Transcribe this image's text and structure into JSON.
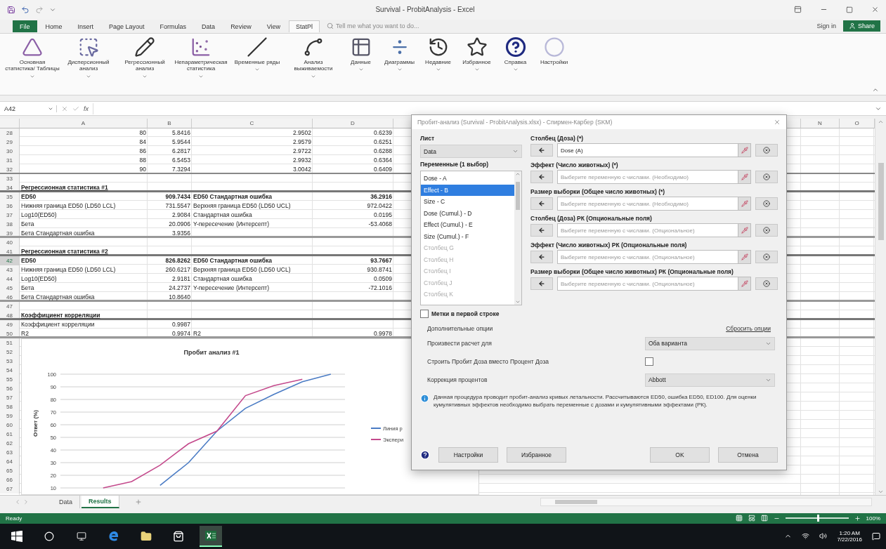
{
  "window": {
    "title": "Survival - ProbitAnalysis - Excel",
    "sign_in": "Sign in",
    "share": "Share"
  },
  "ribbon_tabs": [
    {
      "label": "File",
      "kind": "file",
      "selected": false
    },
    {
      "label": "Home",
      "kind": "tab",
      "selected": false
    },
    {
      "label": "Insert",
      "kind": "tab",
      "selected": false
    },
    {
      "label": "Page Layout",
      "kind": "tab",
      "selected": false
    },
    {
      "label": "Formulas",
      "kind": "tab",
      "selected": false
    },
    {
      "label": "Data",
      "kind": "tab",
      "selected": false
    },
    {
      "label": "Review",
      "kind": "tab",
      "selected": false
    },
    {
      "label": "View",
      "kind": "tab",
      "selected": false
    },
    {
      "label": "StatPl",
      "kind": "tab",
      "selected": true
    }
  ],
  "tell_me": "Tell me what you want to do...",
  "ribbon": [
    {
      "label": "Основная статистика/ Таблицы",
      "dropdown": true
    },
    {
      "label": "Дисперсионный анализ",
      "dropdown": true
    },
    {
      "label": "Регрессионный анализ",
      "dropdown": true
    },
    {
      "label": "Непараметрическая статистика",
      "dropdown": true
    },
    {
      "label": "Временные ряды",
      "dropdown": true
    },
    {
      "label": "Анализ выживаемости",
      "dropdown": true
    },
    {
      "label": "Данные",
      "dropdown": true
    },
    {
      "label": "Диаграммы",
      "dropdown": true
    },
    {
      "label": "Недавние",
      "dropdown": true
    },
    {
      "label": "Избранное",
      "dropdown": true
    },
    {
      "label": "Справка",
      "dropdown": true
    },
    {
      "label": "Настройки",
      "dropdown": false
    }
  ],
  "formula_bar": {
    "name_box": "A42",
    "fx": "fx"
  },
  "sheet": {
    "columns": [
      "A",
      "B",
      "C",
      "D",
      "N",
      "O"
    ],
    "rows": [
      {
        "num": "28",
        "kind": "data",
        "bold": false,
        "selected": false,
        "cells": [
          "80",
          "5.8416",
          "2.9502",
          "0.6239"
        ]
      },
      {
        "num": "29",
        "kind": "data",
        "bold": false,
        "selected": false,
        "cells": [
          "84",
          "5.9544",
          "2.9579",
          "0.6251"
        ]
      },
      {
        "num": "30",
        "kind": "data",
        "bold": false,
        "selected": false,
        "cells": [
          "86",
          "6.2817",
          "2.9722",
          "0.6288"
        ]
      },
      {
        "num": "31",
        "kind": "data",
        "bold": false,
        "selected": false,
        "cells": [
          "88",
          "6.5453",
          "2.9932",
          "0.6364"
        ]
      },
      {
        "num": "32",
        "kind": "data_last",
        "bold": false,
        "selected": false,
        "cells": [
          "90",
          "7.3294",
          "3.0042",
          "0.6409"
        ]
      },
      {
        "num": "33",
        "kind": "empty",
        "selected": false,
        "cells": []
      },
      {
        "num": "34",
        "kind": "heading",
        "bold": true,
        "selected": false,
        "cells": [
          "Регрессионная статистика #1"
        ]
      },
      {
        "num": "35",
        "kind": "stat",
        "bold": true,
        "selected": false,
        "cells": [
          "ED50",
          "909.7434",
          "ED50 Стандартная ошибка",
          "36.2916"
        ]
      },
      {
        "num": "36",
        "kind": "stat",
        "bold": false,
        "selected": false,
        "cells": [
          "Нижняя граница ED50 (LD50 LCL)",
          "731.5547",
          "Верхняя граница ED50 (LD50 UCL)",
          "972.0422"
        ]
      },
      {
        "num": "37",
        "kind": "stat",
        "bold": false,
        "selected": false,
        "cells": [
          "Log10(ED50)",
          "2.9084",
          "Стандартная ошибка",
          "0.0195"
        ]
      },
      {
        "num": "38",
        "kind": "stat",
        "bold": false,
        "selected": false,
        "cells": [
          "Бета",
          "20.0906",
          "Y-пересечение (Интерсепт)",
          "-53.4068"
        ]
      },
      {
        "num": "39",
        "kind": "stat_last",
        "bold": false,
        "selected": false,
        "cells": [
          "Бета Стандартная ошибка",
          "3.9356"
        ]
      },
      {
        "num": "40",
        "kind": "empty",
        "selected": false,
        "cells": []
      },
      {
        "num": "41",
        "kind": "heading",
        "bold": true,
        "selected": false,
        "cells": [
          "Регрессионная статистика #2"
        ]
      },
      {
        "num": "42",
        "kind": "stat",
        "bold": true,
        "selected": true,
        "cells": [
          "ED50",
          "826.8262",
          "ED50 Стандартная ошибка",
          "93.7667"
        ]
      },
      {
        "num": "43",
        "kind": "stat",
        "bold": false,
        "selected": false,
        "cells": [
          "Нижняя граница ED50 (LD50 LCL)",
          "260.6217",
          "Верхняя граница ED50 (LD50 UCL)",
          "930.8741"
        ]
      },
      {
        "num": "44",
        "kind": "stat",
        "bold": false,
        "selected": false,
        "cells": [
          "Log10(ED50)",
          "2.9181",
          "Стандартная ошибка",
          "0.0509"
        ]
      },
      {
        "num": "45",
        "kind": "stat",
        "bold": false,
        "selected": false,
        "cells": [
          "Бета",
          "24.2737",
          "Y-пересечение (Интерсепт)",
          "-72.1016"
        ]
      },
      {
        "num": "46",
        "kind": "stat_last",
        "bold": false,
        "selected": false,
        "cells": [
          "Бета Стандартная ошибка",
          "10.8640"
        ]
      },
      {
        "num": "47",
        "kind": "empty",
        "selected": false,
        "cells": []
      },
      {
        "num": "48",
        "kind": "heading",
        "bold": true,
        "selected": false,
        "cells": [
          "Коэффициент корреляции"
        ]
      },
      {
        "num": "49",
        "kind": "stat",
        "bold": false,
        "selected": false,
        "cells": [
          "Коэффициент корреляции",
          "0.9987"
        ]
      },
      {
        "num": "50",
        "kind": "stat_last",
        "bold": false,
        "selected": false,
        "cells": [
          "R2",
          "0.9974",
          "R2",
          "0.9978"
        ]
      },
      {
        "num": "51",
        "kind": "empty",
        "selected": false,
        "cells": []
      },
      {
        "num": "52",
        "kind": "empty",
        "selected": false,
        "cells": []
      },
      {
        "num": "53",
        "kind": "empty",
        "selected": false,
        "cells": []
      },
      {
        "num": "54",
        "kind": "empty",
        "selected": false,
        "cells": []
      },
      {
        "num": "55",
        "kind": "empty",
        "selected": false,
        "cells": []
      },
      {
        "num": "56",
        "kind": "empty",
        "selected": false,
        "cells": []
      },
      {
        "num": "57",
        "kind": "empty",
        "selected": false,
        "cells": []
      },
      {
        "num": "58",
        "kind": "empty",
        "selected": false,
        "cells": []
      },
      {
        "num": "59",
        "kind": "empty",
        "selected": false,
        "cells": []
      },
      {
        "num": "60",
        "kind": "empty",
        "selected": false,
        "cells": []
      },
      {
        "num": "61",
        "kind": "empty",
        "selected": false,
        "cells": []
      },
      {
        "num": "62",
        "kind": "empty",
        "selected": false,
        "cells": []
      },
      {
        "num": "63",
        "kind": "empty",
        "selected": false,
        "cells": []
      },
      {
        "num": "64",
        "kind": "empty",
        "selected": false,
        "cells": []
      },
      {
        "num": "65",
        "kind": "empty",
        "selected": false,
        "cells": []
      },
      {
        "num": "66",
        "kind": "empty",
        "selected": false,
        "cells": []
      },
      {
        "num": "67",
        "kind": "empty",
        "selected": false,
        "cells": []
      }
    ]
  },
  "chart": {
    "chart_data": {
      "type": "line",
      "title": "Пробит анализ #1",
      "ylabel": "Ответ (%)",
      "grid": true,
      "legend": "right",
      "ylim": [
        10,
        100
      ],
      "yticks": [
        10,
        20,
        30,
        40,
        50,
        60,
        70,
        80,
        90,
        100
      ],
      "categories": [
        null,
        null,
        null,
        null,
        null,
        null,
        null,
        null,
        null,
        null
      ],
      "series": [
        {
          "name": "Линия р",
          "color": "#4a7bc4",
          "values": [
            null,
            null,
            null,
            12,
            30,
            55,
            73,
            84,
            94,
            100
          ]
        },
        {
          "name": "Экспери",
          "color": "#c44a8c",
          "values": [
            null,
            10,
            15,
            28,
            45,
            55,
            83,
            91,
            96,
            null
          ]
        }
      ]
    }
  },
  "dialog": {
    "title": "Пробит-анализ (Survival - ProbitAnalysis.xlsx) - Спирмен-Карбер (SKM)",
    "sheet_label": "Лист",
    "sheet_value": "Data",
    "variables_label": "Переменные (1 выбор)",
    "variables": [
      {
        "label": "Dose - A",
        "selected": false,
        "disabled": false
      },
      {
        "label": "Effect - B",
        "selected": true,
        "disabled": false
      },
      {
        "label": "Size - C",
        "selected": false,
        "disabled": false
      },
      {
        "label": "Dose (Cumul.) - D",
        "selected": false,
        "disabled": false
      },
      {
        "label": "Effect (Cumul.) - E",
        "selected": false,
        "disabled": false
      },
      {
        "label": "Size (Cumul.) - F",
        "selected": false,
        "disabled": false
      },
      {
        "label": "Столбец G",
        "selected": false,
        "disabled": true
      },
      {
        "label": "Столбец H",
        "selected": false,
        "disabled": true
      },
      {
        "label": "Столбец I",
        "selected": false,
        "disabled": true
      },
      {
        "label": "Столбец J",
        "selected": false,
        "disabled": true
      },
      {
        "label": "Столбец K",
        "selected": false,
        "disabled": true
      }
    ],
    "fields": [
      {
        "label": "Столбец (Доза) (*)",
        "value": "Dose (A)"
      },
      {
        "label": "Эффект (Число животных) (*)",
        "placeholder": "Выберите переменную с числами. (Необходимо)"
      },
      {
        "label": "Размер выборки (Общее число животных) (*)",
        "placeholder": "Выберите переменную с числами. (Необходимо)"
      },
      {
        "label": "Столбец (Доза) РК (Опциональные поля)",
        "placeholder": "Выберите переменную с числами. (Опциональное)"
      },
      {
        "label": "Эффект (Число животных) РК (Опциональные поля)",
        "placeholder": "Выберите переменную с числами. (Опциональное)"
      },
      {
        "label": "Размер выборки (Общее число животных) РК (Опциональные поля)",
        "placeholder": "Выберите переменную с числами. (Опциональное)"
      }
    ],
    "labels_checkbox": {
      "label": "Метки в первой строке",
      "checked": false
    },
    "options_label": "Дополнительные опции",
    "reset_link": "Сбросить опции",
    "options": [
      {
        "kind": "select",
        "label": "Произвести расчет для",
        "value": "Оба варианта"
      },
      {
        "kind": "checkbox",
        "label": "Строить Пробит Доза вместо Процент Доза",
        "checked": false
      },
      {
        "kind": "select",
        "label": "Коррекция процентов",
        "value": "Abbott"
      }
    ],
    "info": "Данная процедура проводит пробит-анализ кривых летальности. Рассчитываются ED50, ошибка ED50, ED100. Для оценки кумулятивных эффектов необходимо выбрать переменные с дозами и кумулятивными эффектами (РК).",
    "buttons": [
      {
        "label": "Настройки",
        "kind": "left"
      },
      {
        "label": "Избранное",
        "kind": "left"
      },
      {
        "label": "OK",
        "kind": "right"
      },
      {
        "label": "Отмена",
        "kind": "right"
      }
    ]
  },
  "sheet_tabs": [
    {
      "label": "Data",
      "selected": false
    },
    {
      "label": "Results",
      "selected": true
    }
  ],
  "status_bar": {
    "text": "Ready",
    "zoom": "100%",
    "zoom_slider": {
      "level": 0.5
    }
  },
  "taskbar": {
    "time": "1:20 AM",
    "date": "7/22/2016"
  }
}
